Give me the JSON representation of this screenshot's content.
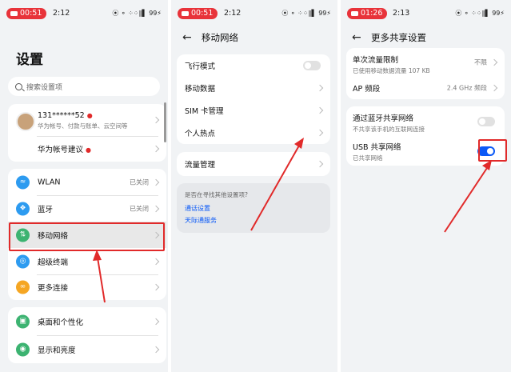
{
  "colors": {
    "accent": "#0a59f7",
    "record": "#e8333a",
    "annotation": "#e12a2a",
    "panel_bg": "#f1f3f5"
  },
  "status_icons": "⦿ ⚬ ⁘⁘∥▌ 99⚡",
  "panel1": {
    "rec_time": "00:51",
    "clock": "2:12",
    "title": "设置",
    "search_placeholder": "搜索设置项",
    "account": {
      "name": "131******52",
      "desc": "华为帐号、付款与账单、云空间等",
      "suggest": "华为帐号建议"
    },
    "items": [
      {
        "label": "WLAN",
        "value": "已关闭",
        "icon": "wifi-icon",
        "color": "#2d9bf0"
      },
      {
        "label": "蓝牙",
        "value": "已关闭",
        "icon": "bluetooth-icon",
        "color": "#2d9bf0"
      },
      {
        "label": "移动网络",
        "value": "",
        "icon": "mobile-network-icon",
        "color": "#3cb371"
      },
      {
        "label": "超级终端",
        "value": "",
        "icon": "super-device-icon",
        "color": "#2d9bf0"
      },
      {
        "label": "更多连接",
        "value": "",
        "icon": "link-icon",
        "color": "#f5a623"
      }
    ],
    "items2": [
      {
        "label": "桌面和个性化",
        "icon": "desktop-icon",
        "color": "#3cb371"
      },
      {
        "label": "显示和亮度",
        "icon": "eye-icon",
        "color": "#3cb371"
      }
    ]
  },
  "panel2": {
    "rec_time": "00:51",
    "clock": "2:12",
    "title": "移动网络",
    "items": [
      "飞行模式",
      "移动数据",
      "SIM 卡管理",
      "个人热点"
    ],
    "traffic": "流量管理",
    "hint_title": "是否在寻找其他设置项?",
    "links": [
      "通话设置",
      "天际通服务"
    ]
  },
  "panel3": {
    "rec_time": "01:26",
    "clock": "2:13",
    "title": "更多共享设置",
    "limit": {
      "label": "单次流量限制",
      "sub": "已使用移动数据流量 107 KB",
      "value": "不限"
    },
    "ap": {
      "label": "AP 频段",
      "value": "2.4 GHz 频段"
    },
    "bt": {
      "label": "通过蓝牙共享网络",
      "sub": "不共享该手机的互联网连接",
      "on": false
    },
    "usb": {
      "label": "USB 共享网络",
      "sub": "已共享网络",
      "on": true
    }
  }
}
